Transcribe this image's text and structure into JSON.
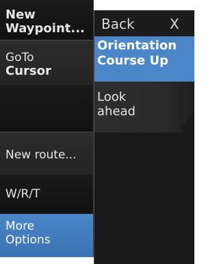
{
  "left_menu": {
    "items": [
      {
        "line1": "New",
        "line2": "Waypoint..."
      },
      {
        "line1": "GoTo",
        "line2": "Cursor"
      },
      {
        "label": ""
      },
      {
        "label": "New route..."
      },
      {
        "label": "W/R/T"
      },
      {
        "line1": "More",
        "line2": "Options"
      }
    ],
    "selected_index": 5
  },
  "submenu": {
    "back_label": "Back",
    "close_label": "X",
    "items": [
      {
        "line1": "Orientation",
        "line2": "Course Up"
      },
      {
        "line1": "Look",
        "line2": "ahead"
      }
    ],
    "selected_index": 0
  },
  "colors": {
    "selection": "#4a86c8",
    "background": "#171717",
    "text": "#e6e6e6"
  }
}
